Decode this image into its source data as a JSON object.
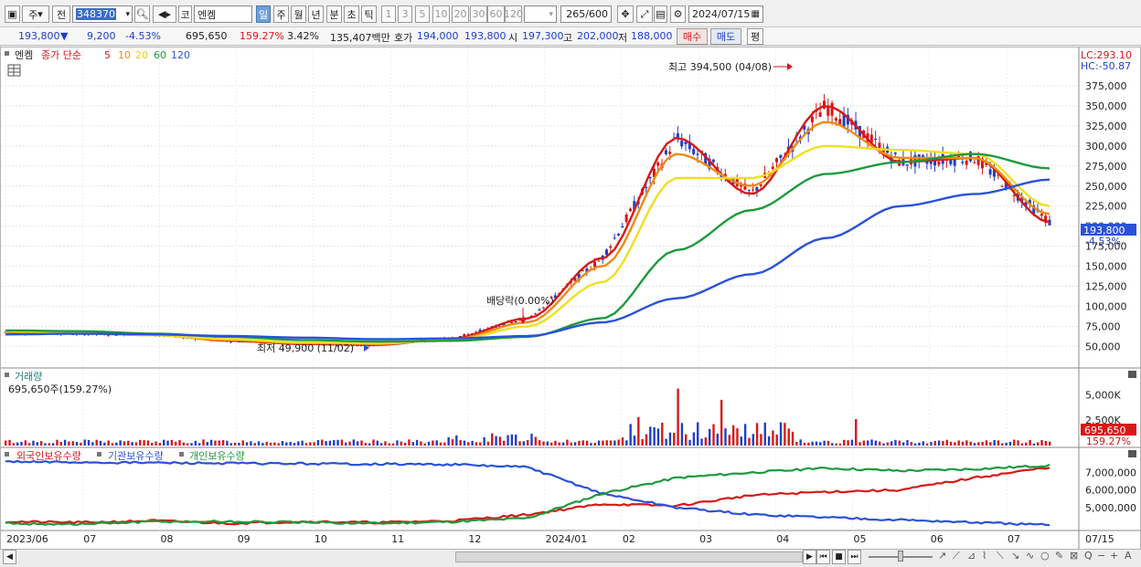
{
  "toolbar": {
    "type_label": "주",
    "prev_label": "전",
    "code": "348370",
    "market_label": "코",
    "stock_name": "엔켐",
    "periods": [
      "일",
      "주",
      "월",
      "년",
      "분",
      "초",
      "틱"
    ],
    "active_period": "일",
    "intervals": [
      "1",
      "3",
      "5",
      "10",
      "20",
      "30",
      "60",
      "120"
    ],
    "count": "265",
    "total": "/600",
    "date": "2024/07/15"
  },
  "quote": {
    "price": "193,800",
    "down_arrow": "▼",
    "change": "9,200",
    "change_pct": "-4.53%",
    "volume": "695,650",
    "volume_ratio": "159.27%",
    "turnover": "3.42%",
    "amount": "135,407백만",
    "ask_label": "호가",
    "ask": "194,000",
    "bid": "193,800",
    "open_label": "시",
    "open": "197,300",
    "high_label": "고",
    "high": "202,000",
    "low_label": "저",
    "low": "188,000",
    "buy_label": "매수",
    "sell_label": "매도",
    "eval_label": "평"
  },
  "price_pane": {
    "name": "엔켐",
    "legend_prefix": "종가 단순",
    "ma_periods": [
      "5",
      "10",
      "20",
      "60",
      "120"
    ],
    "ma_colors": [
      "#d81818",
      "#f08a10",
      "#f0e020",
      "#1e9a3c",
      "#2a52d8"
    ],
    "lc_label": "LC:293.10",
    "hc_label": "HC:-50.87",
    "high_annotation": "최고 394,500 (04/08)",
    "low_annotation": "최저 49,900 (11/02)",
    "dividend_annotation": "배당락(0.00%)",
    "current_price": "193,800",
    "current_pct": "-4.53%",
    "y_ticks": [
      "375,000",
      "350,000",
      "325,000",
      "300,000",
      "275,000",
      "250,000",
      "225,000",
      "200,000",
      "175,000",
      "150,000",
      "125,000",
      "100,000",
      "75,000",
      "50,000"
    ]
  },
  "volume_pane": {
    "title": "거래량",
    "value": "695,650주(159.27%)",
    "y_ticks": [
      "5,000K",
      "2,500K"
    ],
    "current": "695,650",
    "current_pct": "159.27%"
  },
  "holdings_pane": {
    "legends": [
      "외국인보유수량",
      "기관보유수량",
      "개인보유수량"
    ],
    "legend_colors": [
      "#d81818",
      "#2a52d8",
      "#1e9a3c"
    ],
    "y_ticks": [
      "7,000,000",
      "6,000,000",
      "5,000,000"
    ]
  },
  "x_axis": {
    "labels": [
      "2023/06",
      "07",
      "08",
      "09",
      "10",
      "11",
      "12",
      "2024/01",
      "02",
      "03",
      "04",
      "05",
      "06",
      "07"
    ],
    "end_label": "07/15"
  },
  "chart_data": {
    "type": "line",
    "title": "",
    "x": [
      "2023/06",
      "07",
      "08",
      "09",
      "10",
      "11",
      "12",
      "2024/01",
      "02",
      "03",
      "04",
      "05",
      "06",
      "07"
    ],
    "series": [
      {
        "name": "5",
        "values": [
          68000,
          66000,
          65000,
          57000,
          53000,
          52000,
          60000,
          85000,
          160000,
          310000,
          240000,
          350000,
          280000,
          285000,
          205000
        ]
      },
      {
        "name": "10",
        "values": [
          68000,
          66000,
          64000,
          58000,
          54000,
          53000,
          59000,
          80000,
          150000,
          290000,
          250000,
          330000,
          285000,
          285000,
          215000
        ]
      },
      {
        "name": "20",
        "values": [
          69000,
          67000,
          64000,
          59000,
          55000,
          54000,
          58000,
          75000,
          130000,
          260000,
          260000,
          300000,
          295000,
          290000,
          225000
        ]
      },
      {
        "name": "60",
        "values": [
          70000,
          69000,
          66000,
          62000,
          58000,
          56000,
          57000,
          62000,
          85000,
          170000,
          220000,
          265000,
          280000,
          290000,
          272000
        ]
      },
      {
        "name": "120",
        "values": [
          65000,
          66000,
          65000,
          63000,
          61000,
          59000,
          60000,
          63000,
          80000,
          110000,
          140000,
          185000,
          225000,
          240000,
          258000
        ]
      }
    ],
    "ylim": [
      30000,
      400000
    ],
    "volume_ylim": [
      0,
      7000
    ],
    "holdings_ylim": [
      3800000,
      7700000
    ],
    "grid": true
  }
}
